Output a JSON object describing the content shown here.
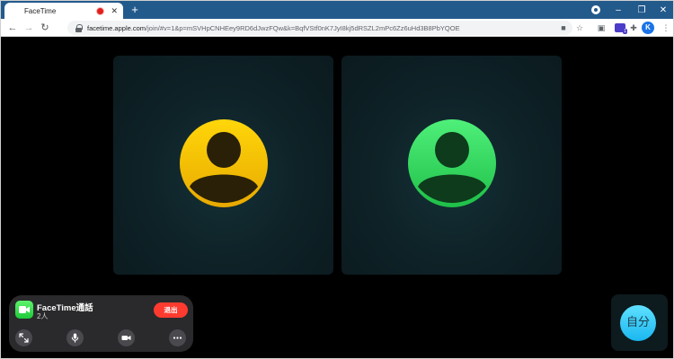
{
  "browser": {
    "tab_title": "FaceTime",
    "favicon": "apple-icon",
    "new_tab_label": "+",
    "profile_initial": "K",
    "address": {
      "host": "facetime.apple.com",
      "path": "/join/#v=1&p=mSVHpCNHEey9RD6dJwzFQw&k=BqfVStf0nK7JyI8kj5dRSZL2mPc6Zz6uHd3B8PbYQOE"
    },
    "window_controls": {
      "minimize": "–",
      "restore": "❐",
      "close": "✕"
    },
    "nav": {
      "back": "←",
      "forward": "→",
      "reload": "↻"
    }
  },
  "call": {
    "app_name": "FaceTime通話",
    "participant_count": "2人",
    "leave_label": "退出",
    "self_label": "自分",
    "participants": [
      {
        "id": "left",
        "avatar_color": "#f5b800"
      },
      {
        "id": "right",
        "avatar_color": "#2fd158"
      }
    ],
    "controls": [
      {
        "name": "expand-button",
        "icon": "expand-icon"
      },
      {
        "name": "mute-button",
        "icon": "microphone-icon"
      },
      {
        "name": "camera-button",
        "icon": "video-camera-icon"
      },
      {
        "name": "more-button",
        "icon": "more-icon"
      }
    ]
  },
  "colors": {
    "tabbar": "#235a8c",
    "leave": "#ff3b30",
    "facetime_green": "#2fd158",
    "self_avatar": "#3fcaf7"
  }
}
